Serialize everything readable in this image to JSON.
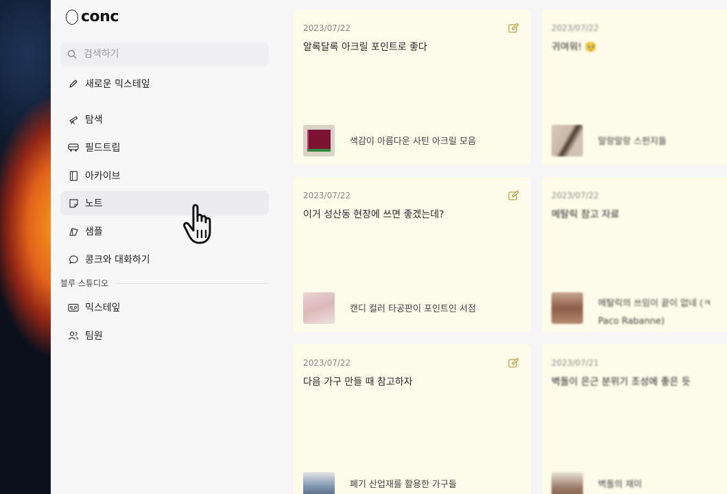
{
  "app": {
    "logo_text": "conc"
  },
  "search": {
    "placeholder": "검색하기"
  },
  "sidebar": {
    "new_label": "새로운 믹스테잎",
    "items": [
      {
        "label": "탐색",
        "icon": "telescope-icon"
      },
      {
        "label": "필드트립",
        "icon": "bus-icon"
      },
      {
        "label": "아카이브",
        "icon": "archive-icon"
      },
      {
        "label": "노트",
        "icon": "note-icon",
        "active": true
      },
      {
        "label": "샘플",
        "icon": "sample-icon"
      },
      {
        "label": "콩크와 대화하기",
        "icon": "chat-bubble-icon"
      }
    ],
    "section_label": "블루 스튜디오",
    "section_items": [
      {
        "label": "믹스테잎",
        "icon": "mixtape-icon"
      },
      {
        "label": "팀원",
        "icon": "team-icon"
      }
    ]
  },
  "notes": [
    {
      "date": "2023/07/22",
      "title": "알록달록 아크릴 포인트로 좋다",
      "caption": "색감이 아름다운 사틴 아크릴 모음",
      "thumb_color": "#8a1f3a",
      "thumb_accent": "#2e8a3a"
    },
    {
      "date": "2023/07/22",
      "title": "귀여워! 🥺",
      "caption": "말랑말랑 스펀지들",
      "thumb_color": "#cbbfb4",
      "thumb_accent": "#5a4a40"
    },
    {
      "date": "2023/07/22",
      "title": "이거 성산동 현장에 쓰면 좋겠는데?",
      "caption": "캔디 컬러 타공판이 포인트인 서점",
      "thumb_color": "#e3c8c8",
      "thumb_accent": "#cfa9a9"
    },
    {
      "date": "2023/07/22",
      "title": "메탈릭 참고 자료",
      "caption": "메탈릭의 쓰임이 끝이 없네 (ㅋ",
      "caption_line2": "Paco Rabanne)",
      "thumb_color": "#b08a78",
      "thumb_accent": "#6e4a3c"
    },
    {
      "date": "2023/07/22",
      "title": "다음 가구 만들 때 참고하자",
      "caption": "폐기 산업재를 활용한 가구들",
      "thumb_color": "#7f97b0",
      "thumb_accent": "#d9d9d9"
    },
    {
      "date": "2023/07/21",
      "title": "벽돌이 은근 분위기 조성에 좋은 듯",
      "caption": "벽돌의 재미",
      "thumb_color": "#9a7a66",
      "thumb_accent": "#e8e1d8"
    }
  ]
}
